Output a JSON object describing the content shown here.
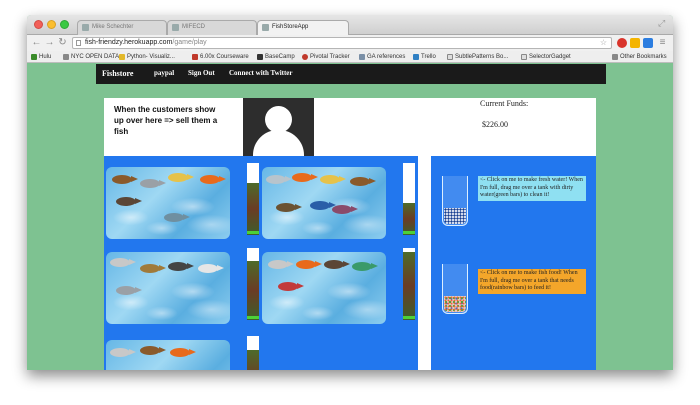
{
  "browser": {
    "tabs": [
      {
        "label": "Mike Schechter",
        "active": false
      },
      {
        "label": "MIFECD",
        "active": false
      },
      {
        "label": "FishStoreApp",
        "active": true
      }
    ],
    "url_host": "fish-friendzy.herokuapp.com",
    "url_path": "/game/play",
    "bookmarks": [
      {
        "label": "Hulu",
        "color": "#3a8b2a"
      },
      {
        "label": "NYC OPEN DATA",
        "color": "#888888"
      },
      {
        "label": "Python- Visualiz...",
        "color": "#e2b82a"
      },
      {
        "label": "6.00x Courseware",
        "color": "#c0392b"
      },
      {
        "label": "BaseCamp",
        "color": "#333333"
      },
      {
        "label": "Pivotal Tracker",
        "color": "#c0392b"
      },
      {
        "label": "GA references",
        "color": "#7a8fa6"
      },
      {
        "label": "Trello",
        "color": "#2f80c3"
      },
      {
        "label": "SubtlePatterns Bo...",
        "color": "#888888"
      },
      {
        "label": "SelectorGadget",
        "color": "#888888"
      }
    ],
    "other_bookmarks": "Other Bookmarks"
  },
  "nav": {
    "brand": "Fishstore",
    "links": [
      "paypal",
      "Sign Out",
      "Connect with Twitter"
    ]
  },
  "header": {
    "intro_text": "When the customers show up over here => sell them a fish",
    "funds_label": "Current Funds:",
    "funds_value": "$226.00"
  },
  "tanks": [
    {
      "dirt_level": 0.72
    },
    {
      "dirt_level": 0.45
    },
    {
      "dirt_level": 0.82
    },
    {
      "dirt_level": 0.95
    },
    {
      "dirt_level": 0.8
    }
  ],
  "tools": {
    "water_tip": "<- Click on me to make fresh water! When I'm full, drag me over a tank with dirty water(green bars) to clean it!",
    "food_tip": "<- Click on me to make fish food! When I'm full, drag me over a tank that needs food(rainbow bars) to feed it!"
  }
}
